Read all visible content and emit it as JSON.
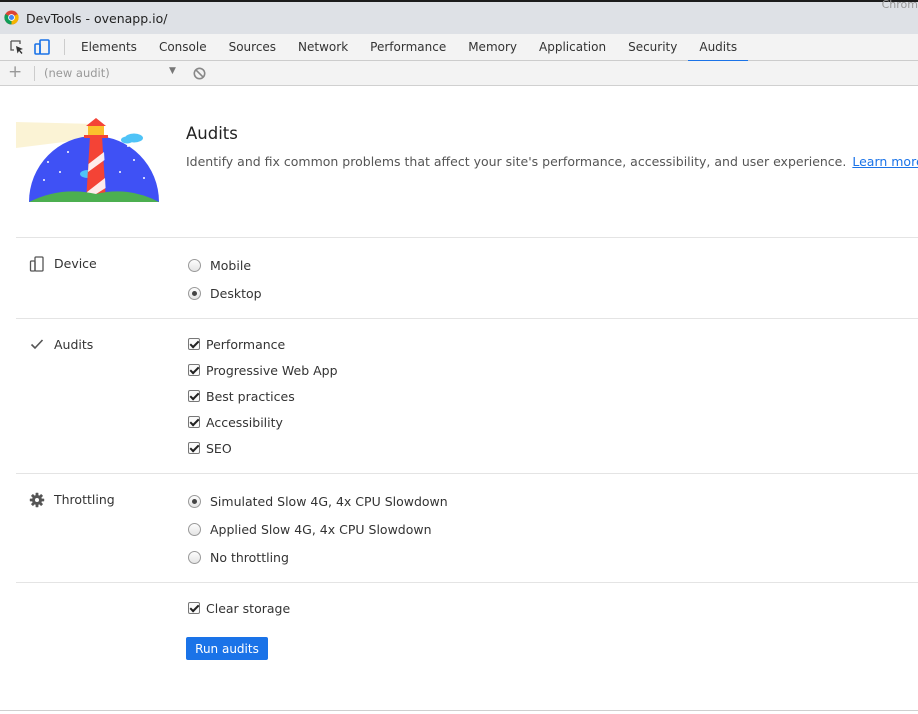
{
  "window": {
    "title": "DevTools - ovenapp.io/",
    "corner_text": "Chrom"
  },
  "tabs": [
    {
      "label": "Elements"
    },
    {
      "label": "Console"
    },
    {
      "label": "Sources"
    },
    {
      "label": "Network"
    },
    {
      "label": "Performance"
    },
    {
      "label": "Memory"
    },
    {
      "label": "Application"
    },
    {
      "label": "Security"
    },
    {
      "label": "Audits",
      "active": true
    }
  ],
  "toolbar": {
    "new_label": "+",
    "select_value": "(new audit)",
    "select_arrow": "▼"
  },
  "hero": {
    "title": "Audits",
    "description": "Identify and fix common problems that affect your site's performance, accessibility, and user experience.",
    "link": "Learn more"
  },
  "device": {
    "label": "Device",
    "options": [
      {
        "label": "Mobile",
        "selected": false
      },
      {
        "label": "Desktop",
        "selected": true
      }
    ]
  },
  "audits": {
    "label": "Audits",
    "options": [
      {
        "label": "Performance",
        "checked": true
      },
      {
        "label": "Progressive Web App",
        "checked": true
      },
      {
        "label": "Best practices",
        "checked": true
      },
      {
        "label": "Accessibility",
        "checked": true
      },
      {
        "label": "SEO",
        "checked": true
      }
    ]
  },
  "throttling": {
    "label": "Throttling",
    "options": [
      {
        "label": "Simulated Slow 4G, 4x CPU Slowdown",
        "selected": true
      },
      {
        "label": "Applied Slow 4G, 4x CPU Slowdown",
        "selected": false
      },
      {
        "label": "No throttling",
        "selected": false
      }
    ]
  },
  "storage": {
    "label": "Clear storage",
    "checked": true
  },
  "run_button": "Run audits",
  "colors": {
    "accent": "#1a73e8",
    "lighthouse_sky": "#3f51f5",
    "lighthouse_hill": "#4caf50",
    "lighthouse_red": "#f44336"
  }
}
